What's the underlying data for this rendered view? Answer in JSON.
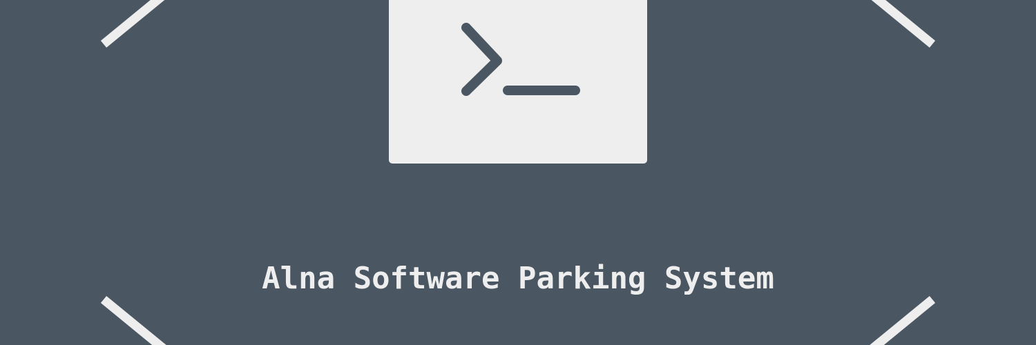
{
  "banner": {
    "title": "Alna Software Parking System",
    "icon": "terminal-prompt-icon",
    "colors": {
      "background": "#4a5661",
      "foreground": "#eeeeee"
    }
  }
}
